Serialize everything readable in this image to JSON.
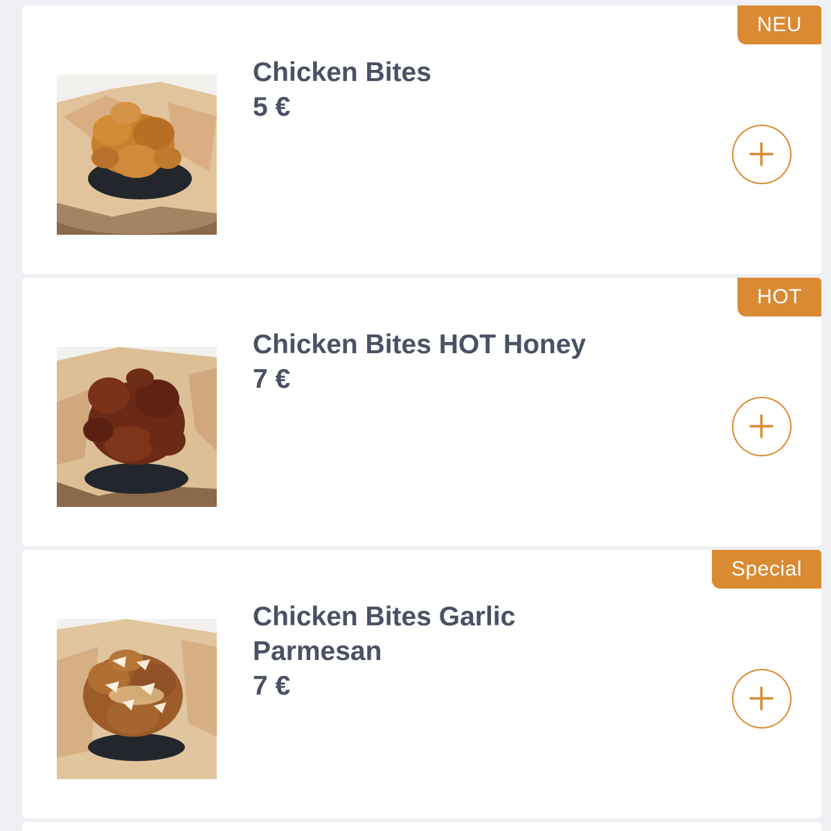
{
  "theme": {
    "accent": "#d98a33",
    "text": "#4a5164",
    "card_bg": "#ffffff",
    "page_bg": "#eef0f3"
  },
  "products": [
    {
      "badge": "NEU",
      "name": "Chicken Bites",
      "price": "5 €",
      "image": "crispy-chicken-bites-photo",
      "add_icon": "plus-icon"
    },
    {
      "badge": "HOT",
      "name": "Chicken Bites HOT Honey",
      "price": "7 €",
      "image": "hot-honey-chicken-bites-photo",
      "add_icon": "plus-icon"
    },
    {
      "badge": "Special",
      "name": "Chicken Bites Garlic Parmesan",
      "price": "7 €",
      "image": "garlic-parmesan-chicken-bites-photo",
      "add_icon": "plus-icon"
    }
  ]
}
